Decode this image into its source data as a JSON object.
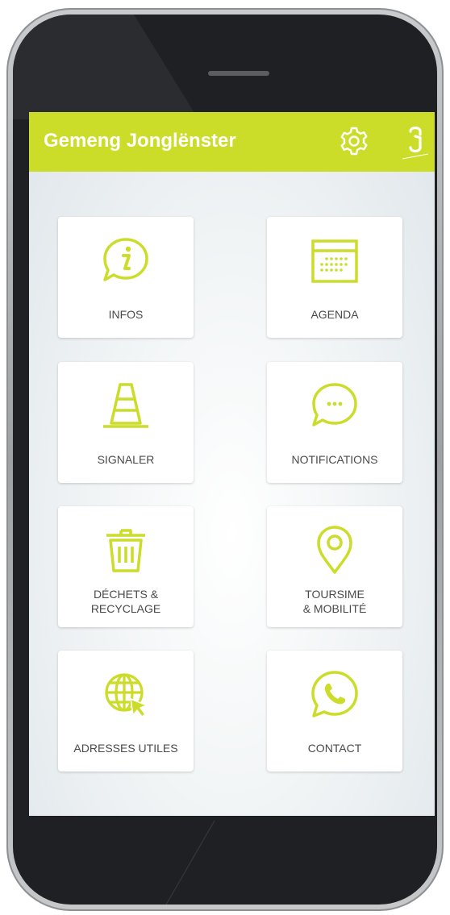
{
  "app": {
    "title": "Gemeng Jonglënster"
  },
  "colors": {
    "accent": "#cbdc29",
    "tile_label": "#4a4a4a"
  },
  "header": {
    "settings_icon": "gear-icon",
    "logo_icon": "commune-logo-icon"
  },
  "tiles": [
    {
      "label": "INFOS",
      "icon": "info-speech-bubble-icon"
    },
    {
      "label": "AGENDA",
      "icon": "calendar-icon"
    },
    {
      "label": "SIGNALER",
      "icon": "traffic-cone-icon"
    },
    {
      "label": "NOTIFICATIONS",
      "icon": "chat-bubble-icon"
    },
    {
      "label": "DÉCHETS &\nRECYCLAGE",
      "icon": "trash-bin-icon"
    },
    {
      "label": "TOURSIME\n& MOBILITÉ",
      "icon": "location-pin-icon"
    },
    {
      "label": "ADRESSES UTILES",
      "icon": "globe-cursor-icon"
    },
    {
      "label": "CONTACT",
      "icon": "whatsapp-phone-icon"
    }
  ]
}
